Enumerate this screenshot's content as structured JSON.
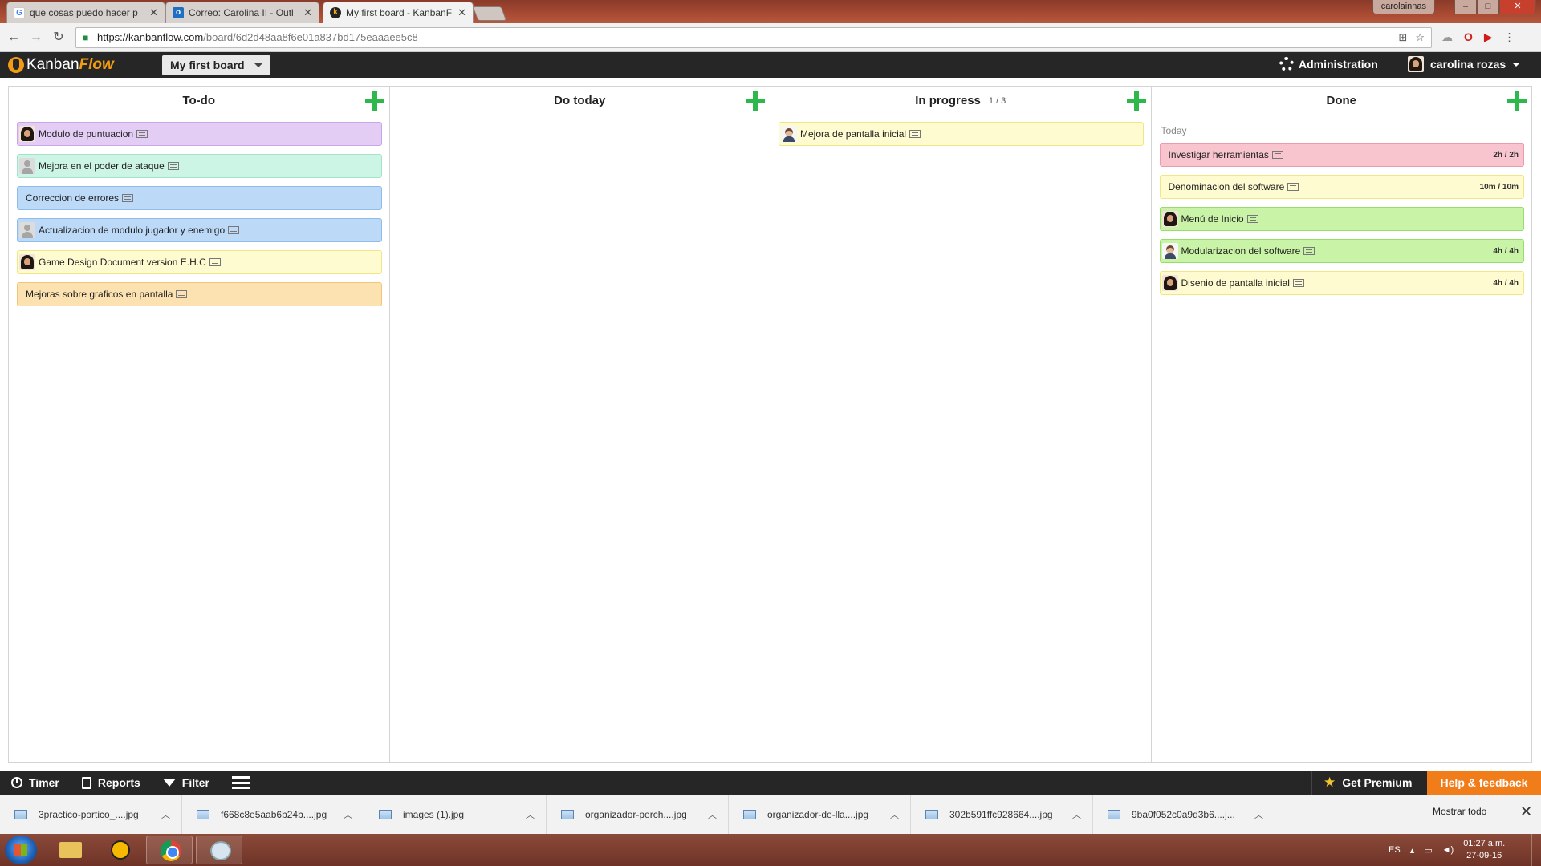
{
  "browser": {
    "tabs": [
      {
        "title": "que cosas puedo hacer p",
        "favicon": "google-icon",
        "active": false
      },
      {
        "title": "Correo: Carolina II - Outl",
        "favicon": "outlook-icon",
        "active": false
      },
      {
        "title": "My first board - KanbanF",
        "favicon": "kanbanflow-icon",
        "active": true
      }
    ],
    "window_user": "carolainnas",
    "window_buttons": {
      "minimize": "–",
      "maximize": "□",
      "close": "✕"
    },
    "url_host": "https://kanbanflow.com",
    "url_path": "/board/6d2d48aa8f6e01a837bd175eaaaee5c8"
  },
  "app": {
    "logo_kanban": "Kanban",
    "logo_flow": "Flow",
    "board_name": "My first board",
    "administration": "Administration",
    "user_name": "carolina rozas"
  },
  "columns": [
    {
      "name": "To-do",
      "wip": "",
      "groups": [
        {
          "label": "",
          "tasks": [
            {
              "name": "Modulo de puntuacion",
              "color": "purple",
              "avatar": "dark",
              "time": ""
            },
            {
              "name": "Mejora en el poder de ataque",
              "color": "mint",
              "avatar": "grey",
              "time": ""
            },
            {
              "name": "Correccion de errores",
              "color": "blue",
              "avatar": "",
              "time": ""
            },
            {
              "name": "Actualizacion de modulo jugador y enemigo",
              "color": "blue",
              "avatar": "grey",
              "time": ""
            },
            {
              "name": "Game Design Document version E.H.C",
              "color": "yellow",
              "avatar": "dark",
              "time": ""
            },
            {
              "name": "Mejoras sobre graficos en pantalla",
              "color": "orange",
              "avatar": "",
              "time": ""
            }
          ]
        }
      ]
    },
    {
      "name": "Do today",
      "wip": "",
      "groups": []
    },
    {
      "name": "In progress",
      "wip": "1 / 3",
      "groups": [
        {
          "label": "",
          "tasks": [
            {
              "name": "Mejora de pantalla inicial",
              "color": "yellow",
              "avatar": "man",
              "time": ""
            }
          ]
        }
      ]
    },
    {
      "name": "Done",
      "wip": "",
      "groups": [
        {
          "label": "Today",
          "tasks": [
            {
              "name": "Investigar herramientas",
              "color": "red",
              "avatar": "",
              "time": "2h / 2h"
            },
            {
              "name": "Denominacion del software",
              "color": "yellow",
              "avatar": "",
              "time": "10m / 10m"
            },
            {
              "name": "Menú de Inicio",
              "color": "green",
              "avatar": "dark",
              "time": ""
            },
            {
              "name": "Modularizacion del software",
              "color": "green",
              "avatar": "man",
              "time": "4h / 4h"
            },
            {
              "name": "Disenio de pantalla inicial",
              "color": "yellow",
              "avatar": "dark",
              "time": "4h / 4h"
            }
          ]
        }
      ]
    }
  ],
  "footer": {
    "timer": "Timer",
    "reports": "Reports",
    "filter": "Filter",
    "get_premium": "Get Premium",
    "help": "Help & feedback"
  },
  "downloads": {
    "items": [
      "3practico-portico_....jpg",
      "f668c8e5aab6b24b....jpg",
      "images (1).jpg",
      "organizador-perch....jpg",
      "organizador-de-lla....jpg",
      "302b591ffc928664....jpg",
      "9ba0f052c0a9d3b6....j..."
    ],
    "show_all": "Mostrar todo"
  },
  "taskbar": {
    "language": "ES",
    "time": "01:27 a.m.",
    "date": "27-09-16"
  },
  "colors": {
    "accent": "#f39c12",
    "add_button": "#2eb84b",
    "help_button": "#f07c1a",
    "app_bar": "#262626"
  }
}
